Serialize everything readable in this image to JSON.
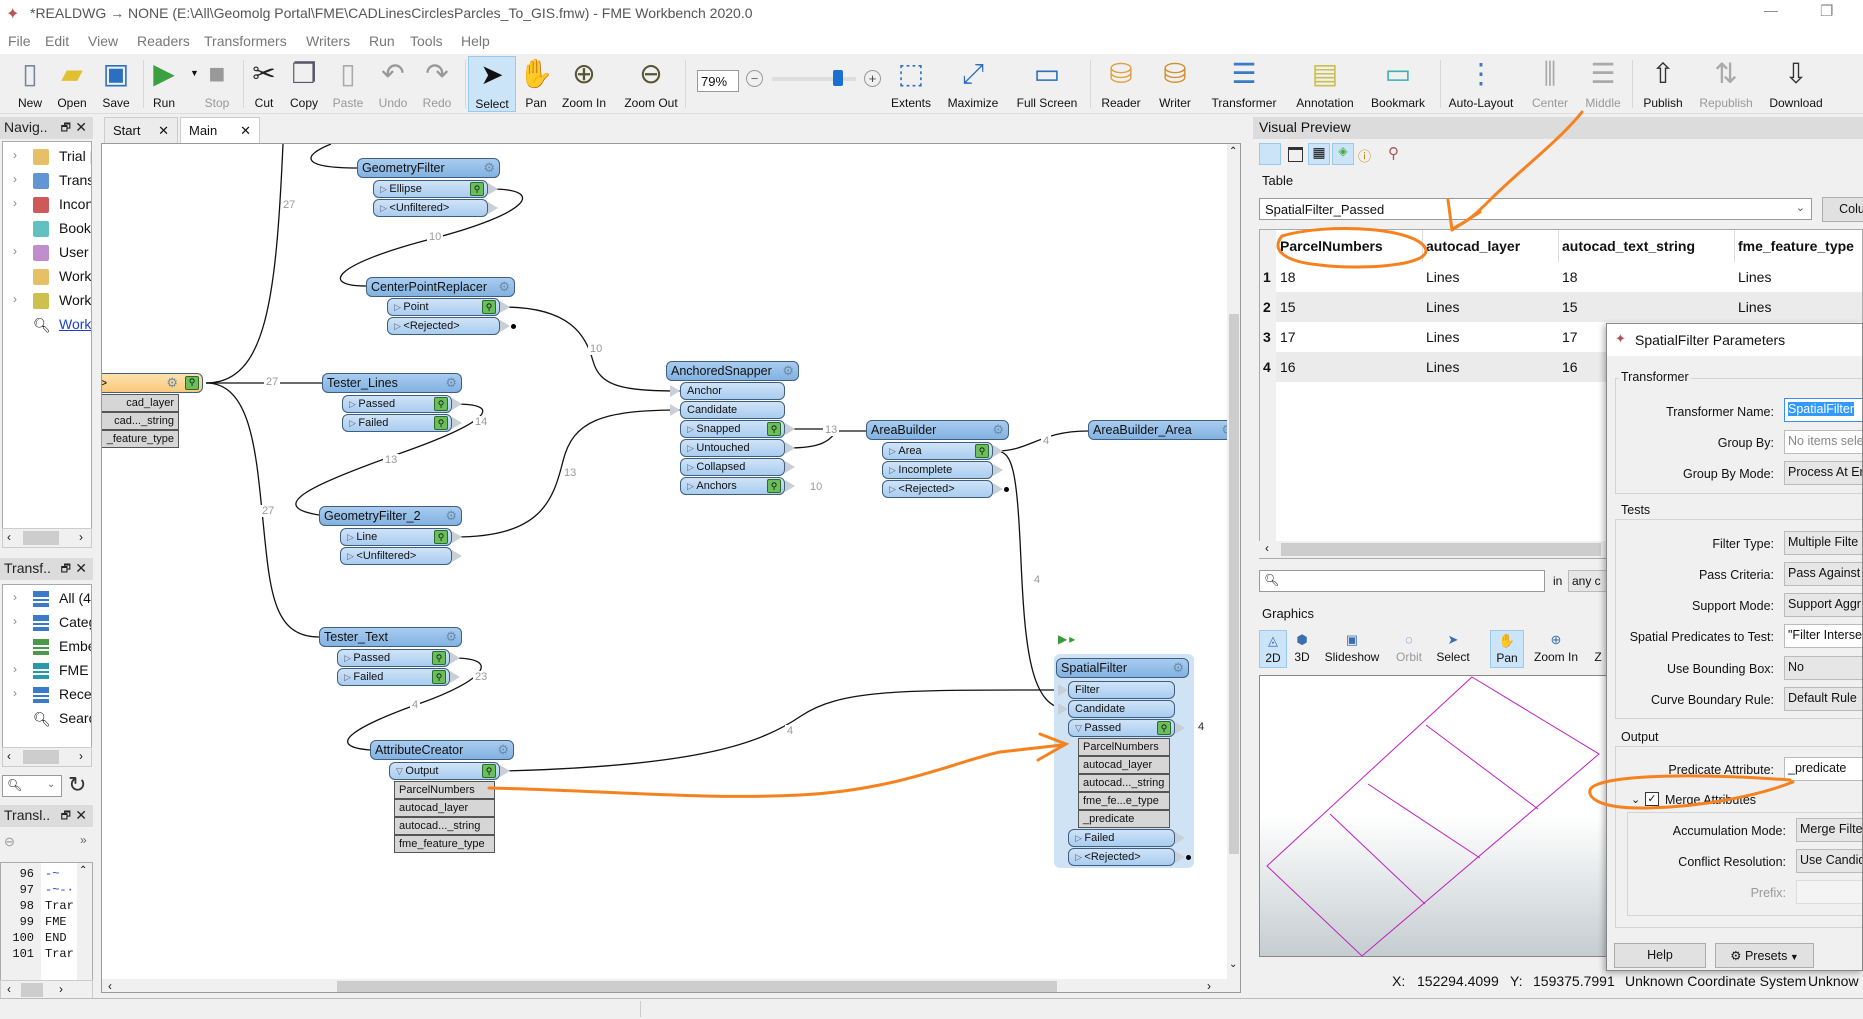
{
  "window": {
    "title": "*REALDWG → NONE (E:\\All\\Geomolg Portal\\FME\\CADLinesCirclesParcles_To_GIS.fmw) - FME Workbench 2020.0",
    "minimize": "—",
    "restore": "❐"
  },
  "menu": [
    "File",
    "Edit",
    "View",
    "Readers",
    "Transformers",
    "Writers",
    "Run",
    "Tools",
    "Help"
  ],
  "toolbar": {
    "buttons": [
      {
        "label": "New",
        "icon": "new-file-icon",
        "state": "enabled"
      },
      {
        "label": "Open",
        "icon": "folder-icon",
        "state": "enabled"
      },
      {
        "label": "Save",
        "icon": "save-icon",
        "state": "enabled"
      },
      {
        "label": "Run",
        "icon": "play-icon",
        "state": "enabled"
      },
      {
        "label": "Stop",
        "icon": "stop-icon",
        "state": "disabled"
      },
      {
        "label": "Cut",
        "icon": "scissors-icon",
        "state": "enabled"
      },
      {
        "label": "Copy",
        "icon": "copy-icon",
        "state": "enabled"
      },
      {
        "label": "Paste",
        "icon": "clipboard-icon",
        "state": "disabled"
      },
      {
        "label": "Undo",
        "icon": "undo-icon",
        "state": "disabled"
      },
      {
        "label": "Redo",
        "icon": "redo-icon",
        "state": "disabled"
      },
      {
        "label": "Select",
        "icon": "cursor-icon",
        "state": "active"
      },
      {
        "label": "Pan",
        "icon": "hand-icon",
        "state": "enabled"
      },
      {
        "label": "Zoom In",
        "icon": "zoom-in-icon",
        "state": "enabled"
      },
      {
        "label": "Zoom Out",
        "icon": "zoom-out-icon",
        "state": "enabled"
      },
      {
        "label": "Extents",
        "icon": "extents-icon",
        "state": "enabled"
      },
      {
        "label": "Maximize",
        "icon": "maximize-icon",
        "state": "enabled"
      },
      {
        "label": "Full Screen",
        "icon": "monitor-icon",
        "state": "enabled"
      },
      {
        "label": "Reader",
        "icon": "reader-icon",
        "state": "enabled"
      },
      {
        "label": "Writer",
        "icon": "writer-icon",
        "state": "enabled"
      },
      {
        "label": "Transformer",
        "icon": "transformer-icon",
        "state": "enabled"
      },
      {
        "label": "Annotation",
        "icon": "annotation-icon",
        "state": "enabled"
      },
      {
        "label": "Bookmark",
        "icon": "bookmark-icon",
        "state": "enabled"
      },
      {
        "label": "Auto-Layout",
        "icon": "auto-layout-icon",
        "state": "enabled"
      },
      {
        "label": "Center",
        "icon": "align-center-icon",
        "state": "disabled"
      },
      {
        "label": "Middle",
        "icon": "align-middle-icon",
        "state": "disabled"
      },
      {
        "label": "Publish",
        "icon": "publish-icon",
        "state": "enabled"
      },
      {
        "label": "Republish",
        "icon": "republish-icon",
        "state": "disabled"
      },
      {
        "label": "Download",
        "icon": "download-icon",
        "state": "enabled"
      }
    ],
    "zoom_value": "79%",
    "zoom_slider_percent": 79
  },
  "tabs": [
    {
      "label": "Start",
      "close": "✕"
    },
    {
      "label": "Main",
      "close": "✕"
    }
  ],
  "navigator": {
    "title": "Navig..",
    "items": [
      {
        "label": "Trial |",
        "icon": "reader-db-icon",
        "expandable": true
      },
      {
        "label": "Trans",
        "icon": "transformer-stack-icon",
        "expandable": true
      },
      {
        "label": "Incon",
        "icon": "incomplete-transformer-icon",
        "expandable": true
      },
      {
        "label": "Book",
        "icon": "bookmark-icon",
        "expandable": false
      },
      {
        "label": "User |",
        "icon": "user-params-icon",
        "expandable": true
      },
      {
        "label": "Work",
        "icon": "workspace-resources-icon",
        "expandable": false
      },
      {
        "label": "Work",
        "icon": "workspace-params-icon",
        "expandable": true
      },
      {
        "label": "Work",
        "icon": "search-icon",
        "expandable": false,
        "link": true
      }
    ]
  },
  "transformers_panel": {
    "title": "Transf..",
    "items": [
      {
        "label": "All (4",
        "color": "#3a7bc8",
        "expandable": true
      },
      {
        "label": "Categ",
        "color": "#3a7bc8",
        "expandable": true
      },
      {
        "label": "Embe",
        "color": "#4a9a4a",
        "expandable": false
      },
      {
        "label": "FME I",
        "color": "#2a9aaa",
        "expandable": true
      },
      {
        "label": "Recer",
        "color": "#3a7bc8",
        "expandable": true
      },
      {
        "label": "Searc",
        "color": "",
        "expandable": false
      }
    ]
  },
  "translation_log": {
    "title": "Transl..",
    "more": "»",
    "lines": [
      {
        "n": "96",
        "text": "-~"
      },
      {
        "n": "97",
        "text": "-~-·"
      },
      {
        "n": "98",
        "text": "Trar"
      },
      {
        "n": "99",
        "text": "FME"
      },
      {
        "n": "100",
        "text": "END"
      },
      {
        "n": "101",
        "text": "Trar"
      }
    ]
  },
  "canvas": {
    "nodes": [
      {
        "id": "reader",
        "header": "All>",
        "type": "reader",
        "inputs": [],
        "outputs": [],
        "attrs": [
          "cad_layer",
          "cad..._string",
          "_feature_type"
        ]
      },
      {
        "id": "gf",
        "header": "GeometryFilter",
        "inputs": [],
        "outputs": [
          {
            "label": "Ellipse",
            "inspect": true
          },
          {
            "label": "<Unfiltered>",
            "inspect": false
          }
        ]
      },
      {
        "id": "cpr",
        "header": "CenterPointReplacer",
        "inputs": [],
        "outputs": [
          {
            "label": "Point",
            "inspect": true
          },
          {
            "label": "<Rejected>",
            "inspect": false,
            "dot": true
          }
        ]
      },
      {
        "id": "tl",
        "header": "Tester_Lines",
        "inputs": [],
        "outputs": [
          {
            "label": "Passed",
            "inspect": true
          },
          {
            "label": "Failed",
            "inspect": true
          }
        ]
      },
      {
        "id": "gf2",
        "header": "GeometryFilter_2",
        "inputs": [],
        "outputs": [
          {
            "label": "Line",
            "inspect": true
          },
          {
            "label": "<Unfiltered>",
            "inspect": false
          }
        ]
      },
      {
        "id": "as",
        "header": "AnchoredSnapper",
        "inputs": [
          "Anchor",
          "Candidate"
        ],
        "outputs": [
          {
            "label": "Snapped",
            "inspect": true
          },
          {
            "label": "Untouched",
            "inspect": false
          },
          {
            "label": "Collapsed",
            "inspect": false
          },
          {
            "label": "Anchors",
            "inspect": true
          }
        ]
      },
      {
        "id": "ab",
        "header": "AreaBuilder",
        "inputs": [],
        "outputs": [
          {
            "label": "Area",
            "inspect": true
          },
          {
            "label": "Incomplete",
            "inspect": false
          },
          {
            "label": "<Rejected>",
            "inspect": false,
            "dot": true
          }
        ]
      },
      {
        "id": "aba",
        "header": "AreaBuilder_Area",
        "type": "writer",
        "inputs": [],
        "outputs": []
      },
      {
        "id": "tt",
        "header": "Tester_Text",
        "inputs": [],
        "outputs": [
          {
            "label": "Passed",
            "inspect": true
          },
          {
            "label": "Failed",
            "inspect": true
          }
        ]
      },
      {
        "id": "ac",
        "header": "AttributeCreator",
        "inputs": [],
        "outputs": [
          {
            "label": "Output",
            "inspect": true,
            "expanded": true,
            "attrs": [
              "ParcelNumbers",
              "autocad_layer",
              "autocad..._string",
              "fme_feature_type"
            ]
          }
        ]
      },
      {
        "id": "sf",
        "header": "SpatialFilter",
        "inputs": [
          "Filter",
          "Candidate"
        ],
        "outputs": [
          {
            "label": "Passed",
            "inspect": true,
            "expanded": true,
            "attrs": [
              "ParcelNumbers",
              "autocad_layer",
              "autocad..._string",
              "fme_fe...e_type",
              "_predicate"
            ]
          },
          {
            "label": "Failed",
            "inspect": false
          },
          {
            "label": "<Rejected>",
            "inspect": false,
            "dot": true
          }
        ]
      }
    ],
    "connection_counts": [
      "27",
      "10",
      "10",
      "27",
      "13",
      "14",
      "13",
      "27",
      "13",
      "10",
      "4",
      "4",
      "23",
      "4",
      "4",
      "4"
    ],
    "annotation_color": "#f5821f"
  },
  "visual_preview": {
    "title": "Visual Preview",
    "table_label": "Table",
    "table_select": "SpatialFilter_Passed",
    "columns_button": "Colu",
    "columns": [
      "ParcelNumbers",
      "autocad_layer",
      "autocad_text_string",
      "fme_feature_type"
    ],
    "rows": [
      {
        "n": "1",
        "cells": [
          "18",
          "Lines",
          "18",
          "Lines"
        ]
      },
      {
        "n": "2",
        "cells": [
          "15",
          "Lines",
          "15",
          "Lines"
        ]
      },
      {
        "n": "3",
        "cells": [
          "17",
          "Lines",
          "17",
          ""
        ]
      },
      {
        "n": "4",
        "cells": [
          "16",
          "Lines",
          "16",
          ""
        ]
      }
    ],
    "search_placeholder": "",
    "search_in": "in",
    "search_scope": "any c",
    "graphics_label": "Graphics",
    "graphics_tools": [
      {
        "label": "2D",
        "active": true
      },
      {
        "label": "3D"
      },
      {
        "label": "Slideshow"
      },
      {
        "label": "Orbit",
        "disabled": true
      },
      {
        "label": "Select"
      },
      {
        "label": "Pan",
        "active": true
      },
      {
        "label": "Zoom In"
      },
      {
        "label": "Z"
      }
    ],
    "geometry_color": "#c020c0",
    "status": {
      "x_label": "X:",
      "x": "152294.4099",
      "y_label": "Y:",
      "y": "159375.7991",
      "crs": "Unknown Coordinate System",
      "units": "Unknow"
    }
  },
  "dialog": {
    "title": "SpatialFilter Parameters",
    "transformer_group": "Transformer",
    "transformer_name_label": "Transformer Name:",
    "transformer_name": "SpatialFilter",
    "group_by_label": "Group By:",
    "group_by": "No items sele",
    "group_by_mode_label": "Group By Mode:",
    "group_by_mode": "Process At Er",
    "tests_group": "Tests",
    "filter_type_label": "Filter Type:",
    "filter_type": "Multiple Filte",
    "pass_criteria_label": "Pass Criteria:",
    "pass_criteria": "Pass Against",
    "support_mode_label": "Support Mode:",
    "support_mode": "Support Aggr",
    "predicates_label": "Spatial Predicates to Test:",
    "predicates": "\"Filter Interse",
    "bbox_label": "Use Bounding Box:",
    "bbox": "No",
    "curve_label": "Curve Boundary Rule:",
    "curve": "Default Rule",
    "output_group": "Output",
    "predicate_attr_label": "Predicate Attribute:",
    "predicate_attr": "_predicate",
    "merge_label": "Merge Attributes",
    "merge_checked": true,
    "accum_label": "Accumulation Mode:",
    "accum": "Merge Filte",
    "conflict_label": "Conflict Resolution:",
    "conflict": "Use Candid",
    "prefix_label": "Prefix:",
    "prefix": "",
    "help": "Help",
    "presets": "Presets"
  }
}
